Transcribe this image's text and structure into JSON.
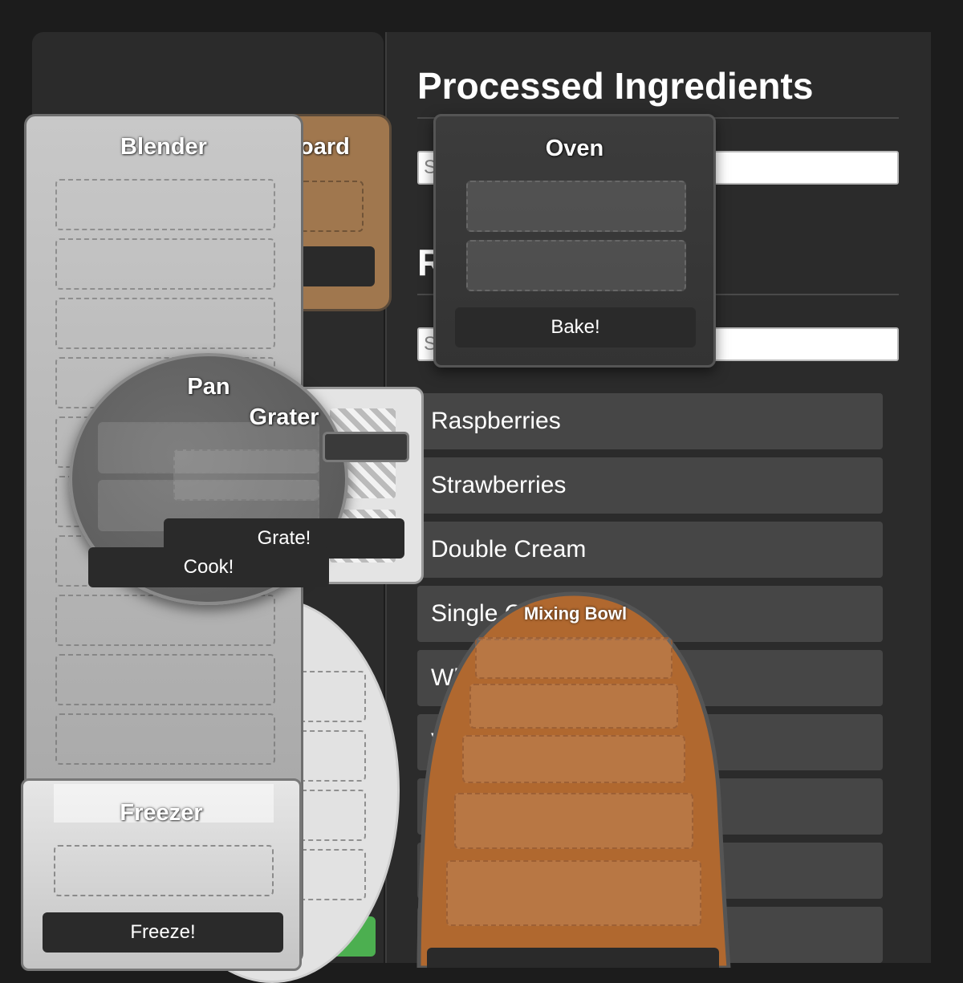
{
  "panel": {
    "processed_heading": "Processed Ingredients",
    "processed_search_prefix": "S",
    "processed_search_tail": ".",
    "raw_heading_first_letter": "R",
    "raw_search_prefix": "S"
  },
  "ingredients": [
    "Raspberries",
    "Strawberries",
    "Double Cream",
    "Single C",
    "Wh",
    "V",
    "",
    "",
    ""
  ],
  "tools": {
    "chopping_board": {
      "title_visible": "oard"
    },
    "blender": {
      "title": "Blender"
    },
    "pan": {
      "title": "Pan",
      "button": "Cook!"
    },
    "grater": {
      "title": "Grater",
      "button": "Grate!"
    },
    "oven": {
      "title": "Oven",
      "button": "Bake!"
    },
    "freezer": {
      "title": "Freezer",
      "button": "Freeze!"
    },
    "mixing_bowl": {
      "title": "Mixing Bowl"
    }
  },
  "colors": {
    "background": "#1c1c1c",
    "panel": "#2b2b2b",
    "list_item": "#464646",
    "chopping_board": "#a0774e",
    "mixing_bowl": "#b0682f",
    "accent_green": "#4caf50"
  }
}
